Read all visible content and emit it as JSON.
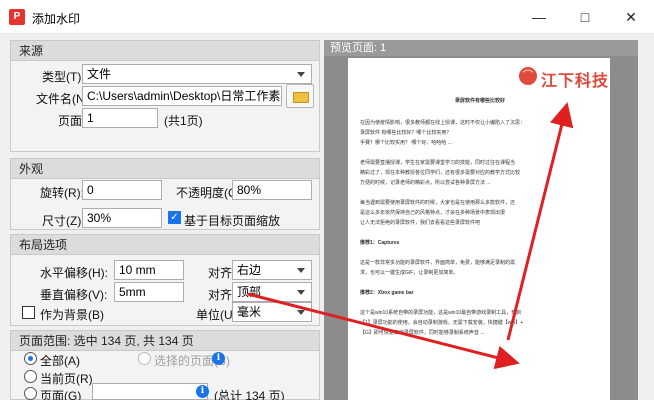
{
  "window": {
    "title": "添加水印",
    "icon_text": "P",
    "minimize": "—",
    "maximize": "□",
    "close": "✕"
  },
  "source": {
    "group_title": "来源",
    "type_label": "类型(T):",
    "type_value": "文件",
    "filename_label": "文件名(N):",
    "filename_value": "C:\\Users\\admin\\Desktop\\日常工作素材\\logo.j",
    "page_label": "页面:",
    "page_value": "1",
    "page_total": "(共1页)"
  },
  "appearance": {
    "group_title": "外观",
    "rotate_label": "旋转(R):",
    "rotate_value": "0",
    "opacity_label": "不透明度(O):",
    "opacity_value": "80%",
    "size_label": "尺寸(Z):",
    "size_value": "30%",
    "scale_checkbox_label": "基于目标页面缩放",
    "scale_checked": "✓"
  },
  "layout": {
    "group_title": "布局选项",
    "hoffset_label": "水平偏移(H):",
    "hoffset_value": "10 mm",
    "voffset_label": "垂直偏移(V):",
    "voffset_value": "5mm",
    "align_label_1": "对齐:",
    "align_value_1": "右边",
    "align_label_2": "对齐:",
    "align_value_2": "顶部",
    "unit_label": "单位(U):",
    "unit_value": "毫米",
    "background_checkbox_label": "作为背景(B)"
  },
  "page_range": {
    "header": "页面范围: 选中 134 页, 共 134 页",
    "all_label": "全部(A)",
    "selected_label": "选择的页面(S)",
    "current_label": "当前页(R)",
    "pages_label": "页面(G)",
    "total_text": "(总计 134 页)"
  },
  "preview": {
    "header": "预览页面: 1",
    "watermark_text": "江下科技",
    "doc_title": "录屏软件有哪些比较好",
    "doc_lines": [
      "在因为使疫情影响，很多教师都在线上授课，这时不仅让小编陷入了沉思：",
      "录屏软件 有哪些比较好？哪个比较实用？",
      "手赛？哪个比较实用？ 哪个好、哈哈哈 ...",
      "",
      "老师需要直播授课，学生在家需要课堂学习的技能，同时过往在课程当",
      "精彩过了，现在本种教授各位同学们，还有很多需要对应的教学方式比较",
      "方便的时候，记录老师的精彩点，所以尝试各种录屏方法 ...",
      "",
      "每当遇到需要使用录屏软件的时候，大家也是在使用那么多款软件，还",
      "是这么多年依然保持自己的风格特点，才会在多种场景中表现出很",
      "让人无法拒绝的录屏软件，我们去看看这些录屏软件吧",
      "",
      "推荐1：Captures",
      "",
      "这是一款非常多功能的录屏软件，界面简单，免费，能够满足录制的需",
      "求，也可以一键生成GIF，让录制更加简单。",
      "",
      "推荐2：Xbox game bar",
      "",
      "这个是win10系统自带的录屏功能，这是win10最自带游戏录制工具，开启",
      "【1】录屏功能的使用，会自动录制游戏，无需下载安装，快捷键【win】+",
      "【G】即可快速启动录屏软件，同时能够录制系统声音 ..."
    ]
  }
}
